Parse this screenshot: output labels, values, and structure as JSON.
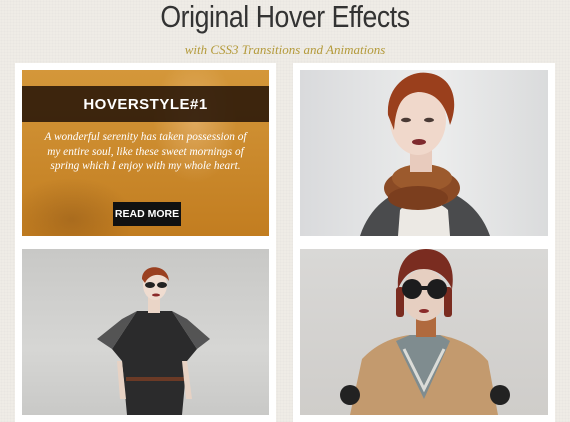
{
  "header": {
    "title": "Original Hover Effects",
    "subtitle": "with CSS3 Transitions and Animations"
  },
  "tiles": [
    {
      "heading": "HOVERSTYLE#1",
      "description": "A wonderful serenity has taken possession of my entire soul, like these sweet mornings of spring which I enjoy with my whole heart.",
      "button_label": "READ MORE"
    }
  ],
  "colors": {
    "background": "#efece6",
    "title": "#333333",
    "subtitle_accent": "#b49a3a",
    "overlay_gold": "#c9892d",
    "overlay_bar": "#281608",
    "button": "#111111"
  }
}
